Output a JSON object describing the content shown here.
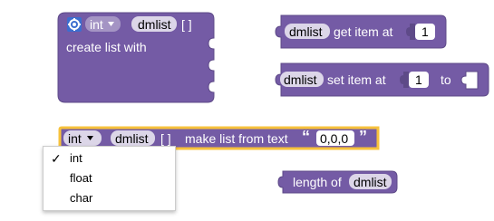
{
  "colors": {
    "block_list": "#745ba5",
    "block_dark": "#5e4a88",
    "block_selected_border": "#f7c23c",
    "field_bg": "#ffffff",
    "field_text": "#000000",
    "gear_icon": "#3c6dcf"
  },
  "block_create": {
    "type_dropdown": "int",
    "var_name": "dmlist",
    "brackets": "[ ]",
    "label": "create list with"
  },
  "block_get": {
    "var_name": "dmlist",
    "label": "get item at",
    "index": "1"
  },
  "block_set": {
    "var_name": "dmlist",
    "label": "set item at",
    "index": "1",
    "to_label": "to"
  },
  "block_from_text": {
    "type_dropdown": "int",
    "var_name": "dmlist",
    "brackets": "[ ]",
    "label": "make list from text",
    "open_quote": "“",
    "text_value": "0,0,0",
    "close_quote": "”"
  },
  "block_length": {
    "label": "length of",
    "var_name": "dmlist"
  },
  "type_menu": {
    "selected": "int",
    "check_mark": "✓",
    "options": [
      "int",
      "float",
      "char"
    ]
  }
}
